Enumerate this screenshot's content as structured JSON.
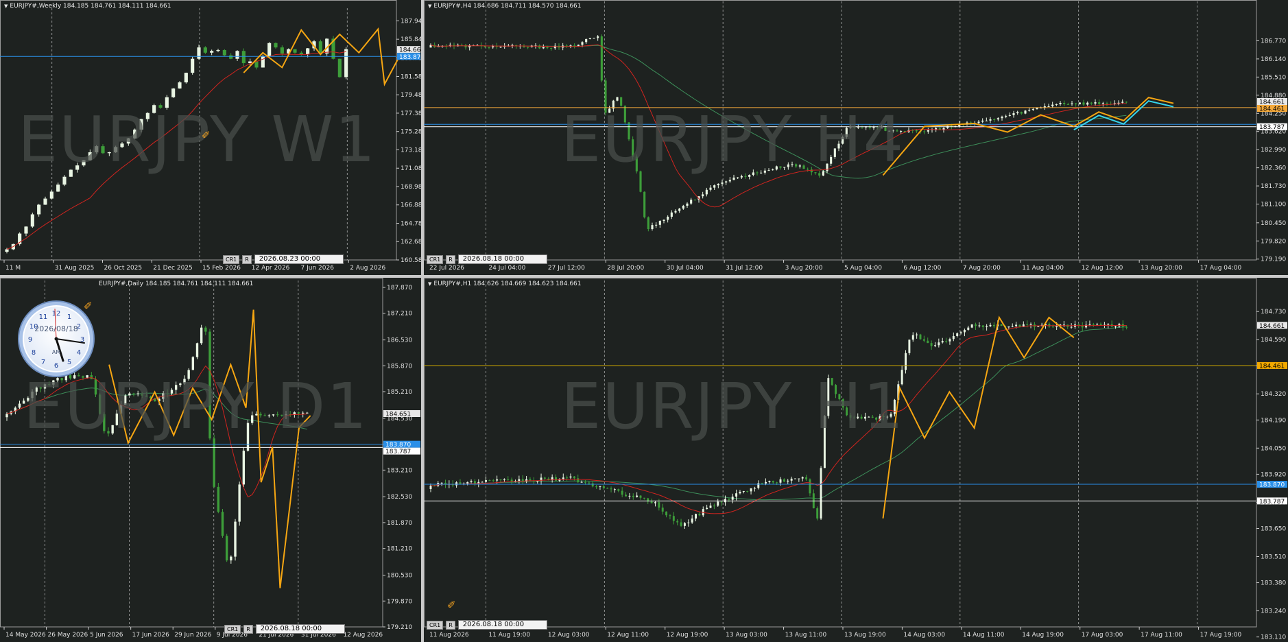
{
  "colors": {
    "bg": "#1e2220",
    "axis": "#cfcfcf",
    "bull": "#e9f5e3",
    "bear": "#3d9e3a",
    "ma_fast": "#d0241f",
    "ma_slow": "#3d8f5a",
    "zigzag": "#f6a612",
    "zigzag2": "#35d6ee",
    "hline_blue": "#2a8fe8",
    "hline_white": "#ffffff",
    "hline_orange": "#f5a93a",
    "hline_gold": "#c9a400"
  },
  "panes": [
    {
      "id": "w1",
      "header": "EURJPY#,Weekly  184.185 184.761 184.111 184.661",
      "watermark": "EURJPY W1",
      "btn1": "CR1",
      "btn2": "R",
      "time": "2026.08.23 00:00",
      "chart_data": {
        "type": "candlestick",
        "ylim": [
          160.58,
          188.6
        ],
        "yticks": [
          "187.940",
          "185.840",
          "183.710",
          "181.580",
          "179.480",
          "177.380",
          "175.280",
          "173.180",
          "171.080",
          "168.980",
          "166.880",
          "164.780",
          "162.680",
          "160.580"
        ],
        "xticks": [
          "11 M",
          "31 Aug 2025",
          "26 Oct 2025",
          "21 Dec 2025",
          "15 Feb 2026",
          "12 Apr 2026",
          "7 Jun 2026",
          "2 Aug 2026"
        ],
        "price_labels": [
          {
            "text": "184.661",
            "value": 184.661,
            "kind": "price"
          },
          {
            "text": "183.870",
            "value": 183.87,
            "kind": "blue"
          }
        ],
        "hlines": [
          {
            "value": 183.87,
            "color": "blue"
          }
        ],
        "closes": [
          161.8,
          162.4,
          163.6,
          164.4,
          165.8,
          166.9,
          167.6,
          168.4,
          169.2,
          170.1,
          170.9,
          171.4,
          172.0,
          172.9,
          173.6,
          172.8,
          172.9,
          173.5,
          173.9,
          174.5,
          175.5,
          176.7,
          177.4,
          178.3,
          178.0,
          179.2,
          180.2,
          180.9,
          182.0,
          183.6,
          184.9,
          184.3,
          184.5,
          184.6,
          184.0,
          183.6,
          184.5,
          183.1,
          183.3,
          182.6,
          183.9,
          185.4,
          184.9,
          184.2,
          184.7,
          184.3,
          184.1,
          184.8,
          185.6,
          184.2,
          185.9,
          183.6,
          181.5,
          184.7
        ],
        "zigzag": [
          [
            37,
            182.0
          ],
          [
            40,
            184.3
          ],
          [
            43,
            182.6
          ],
          [
            46,
            186.9
          ],
          [
            49,
            184.1
          ],
          [
            52,
            186.4
          ],
          [
            55,
            184.3
          ],
          [
            58,
            187.0
          ],
          [
            59,
            180.7
          ],
          [
            62,
            184.8
          ]
        ]
      }
    },
    {
      "id": "h4",
      "header": "EURJPY#,H4  184.686 184.711 184.570 184.661",
      "watermark": "EURJPY H4",
      "btn1": "CR1",
      "btn2": "R",
      "time": "2026.08.18 00:00",
      "chart_data": {
        "type": "candlestick",
        "ylim": [
          179.16,
          187.9
        ],
        "yticks": [
          "186.770",
          "186.140",
          "185.510",
          "184.880",
          "184.250",
          "183.620",
          "182.990",
          "182.360",
          "181.730",
          "181.100",
          "180.450",
          "179.820",
          "179.190"
        ],
        "xticks": [
          "22 Jul 2026",
          "24 Jul 04:00",
          "27 Jul 12:00",
          "28 Jul 20:00",
          "30 Jul 04:00",
          "31 Jul 12:00",
          "3 Aug 20:00",
          "5 Aug 04:00",
          "6 Aug 12:00",
          "7 Aug 20:00",
          "11 Aug 04:00",
          "12 Aug 12:00",
          "13 Aug 20:00",
          "17 Aug 04:00"
        ],
        "price_labels": [
          {
            "text": "184.661",
            "value": 184.661,
            "kind": "price"
          },
          {
            "text": "184.461",
            "value": 184.461,
            "kind": "orange"
          },
          {
            "text": "183.787",
            "value": 183.787,
            "kind": "white"
          }
        ],
        "hlines": [
          {
            "value": 184.45,
            "color": "orange"
          },
          {
            "value": 183.87,
            "color": "blue"
          },
          {
            "value": 183.787,
            "color": "white"
          }
        ],
        "zigzag": [
          [
            0.55,
            182.1
          ],
          [
            0.6,
            183.8
          ],
          [
            0.66,
            183.9
          ],
          [
            0.7,
            183.6
          ],
          [
            0.74,
            184.2
          ],
          [
            0.78,
            183.8
          ],
          [
            0.81,
            184.3
          ],
          [
            0.84,
            184.0
          ],
          [
            0.87,
            184.8
          ],
          [
            0.9,
            184.6
          ]
        ]
      }
    },
    {
      "id": "d1",
      "header": "EURJPY#,Daily  184.185 184.761 184.111 184.661",
      "watermark": "EURJPY D1",
      "btn1": "CR1",
      "btn2": "R",
      "time": "2026.08.18 00:00",
      "chart_data": {
        "type": "candlestick",
        "ylim": [
          179.21,
          187.87
        ],
        "yticks": [
          "187.870",
          "187.210",
          "186.530",
          "185.870",
          "185.210",
          "184.530",
          "183.870",
          "183.210",
          "182.530",
          "181.870",
          "181.210",
          "180.530",
          "179.870",
          "179.210"
        ],
        "xticks": [
          "14 May 2026",
          "26 May 2026",
          "5 Jun 2026",
          "17 Jun 2026",
          "29 Jun 2026",
          "9 Jul 2026",
          "21 Jul 2026",
          "31 Jul 2026",
          "12 Aug 2026"
        ],
        "price_labels": [
          {
            "text": "184.651",
            "value": 184.651,
            "kind": "price"
          },
          {
            "text": "183.870",
            "value": 183.87,
            "kind": "blue"
          },
          {
            "text": "183.787",
            "value": 183.787,
            "kind": "white"
          }
        ],
        "hlines": [
          {
            "value": 183.87,
            "color": "blue"
          },
          {
            "value": 183.787,
            "color": "white"
          }
        ],
        "zigzag": [
          [
            0.28,
            185.9
          ],
          [
            0.33,
            183.9
          ],
          [
            0.4,
            185.2
          ],
          [
            0.45,
            184.1
          ],
          [
            0.5,
            185.3
          ],
          [
            0.55,
            184.5
          ],
          [
            0.6,
            185.9
          ],
          [
            0.64,
            184.8
          ],
          [
            0.66,
            187.3
          ],
          [
            0.68,
            182.9
          ],
          [
            0.71,
            183.8
          ],
          [
            0.73,
            180.2
          ],
          [
            0.78,
            184.3
          ],
          [
            0.81,
            184.6
          ]
        ]
      }
    },
    {
      "id": "h1",
      "header": "EURJPY#,H1  184.626 184.669 184.623 184.661",
      "watermark": "EURJPY H1",
      "btn1": "CR1",
      "btn2": "R",
      "time": "2026.08.18 00:00",
      "chart_data": {
        "type": "candlestick",
        "ylim": [
          183.16,
          184.85
        ],
        "yticks": [
          "184.730",
          "184.590",
          "184.460",
          "184.320",
          "184.190",
          "184.050",
          "183.920",
          "183.780",
          "183.650",
          "183.510",
          "183.380",
          "183.240",
          "183.110"
        ],
        "xticks": [
          "11 Aug 2026",
          "11 Aug 19:00",
          "12 Aug 03:00",
          "12 Aug 11:00",
          "12 Aug 19:00",
          "13 Aug 03:00",
          "13 Aug 11:00",
          "13 Aug 19:00",
          "14 Aug 03:00",
          "14 Aug 11:00",
          "14 Aug 19:00",
          "17 Aug 03:00",
          "17 Aug 11:00",
          "17 Aug 19:00"
        ],
        "price_labels": [
          {
            "text": "184.661",
            "value": 184.661,
            "kind": "price"
          },
          {
            "text": "184.461",
            "value": 184.461,
            "kind": "gold"
          },
          {
            "text": "183.870",
            "value": 183.87,
            "kind": "blue"
          },
          {
            "text": "183.787",
            "value": 183.787,
            "kind": "white"
          }
        ],
        "hlines": [
          {
            "value": 184.461,
            "color": "gold"
          },
          {
            "value": 183.87,
            "color": "blue"
          },
          {
            "value": 183.787,
            "color": "white"
          }
        ],
        "zigzag": [
          [
            0.55,
            183.7
          ],
          [
            0.57,
            184.35
          ],
          [
            0.6,
            184.1
          ],
          [
            0.63,
            184.33
          ],
          [
            0.66,
            184.15
          ],
          [
            0.69,
            184.7
          ],
          [
            0.72,
            184.5
          ],
          [
            0.75,
            184.7
          ],
          [
            0.78,
            184.6
          ]
        ]
      }
    }
  ],
  "clock": {
    "date": "2026/08/18",
    "ampm": "AM"
  }
}
